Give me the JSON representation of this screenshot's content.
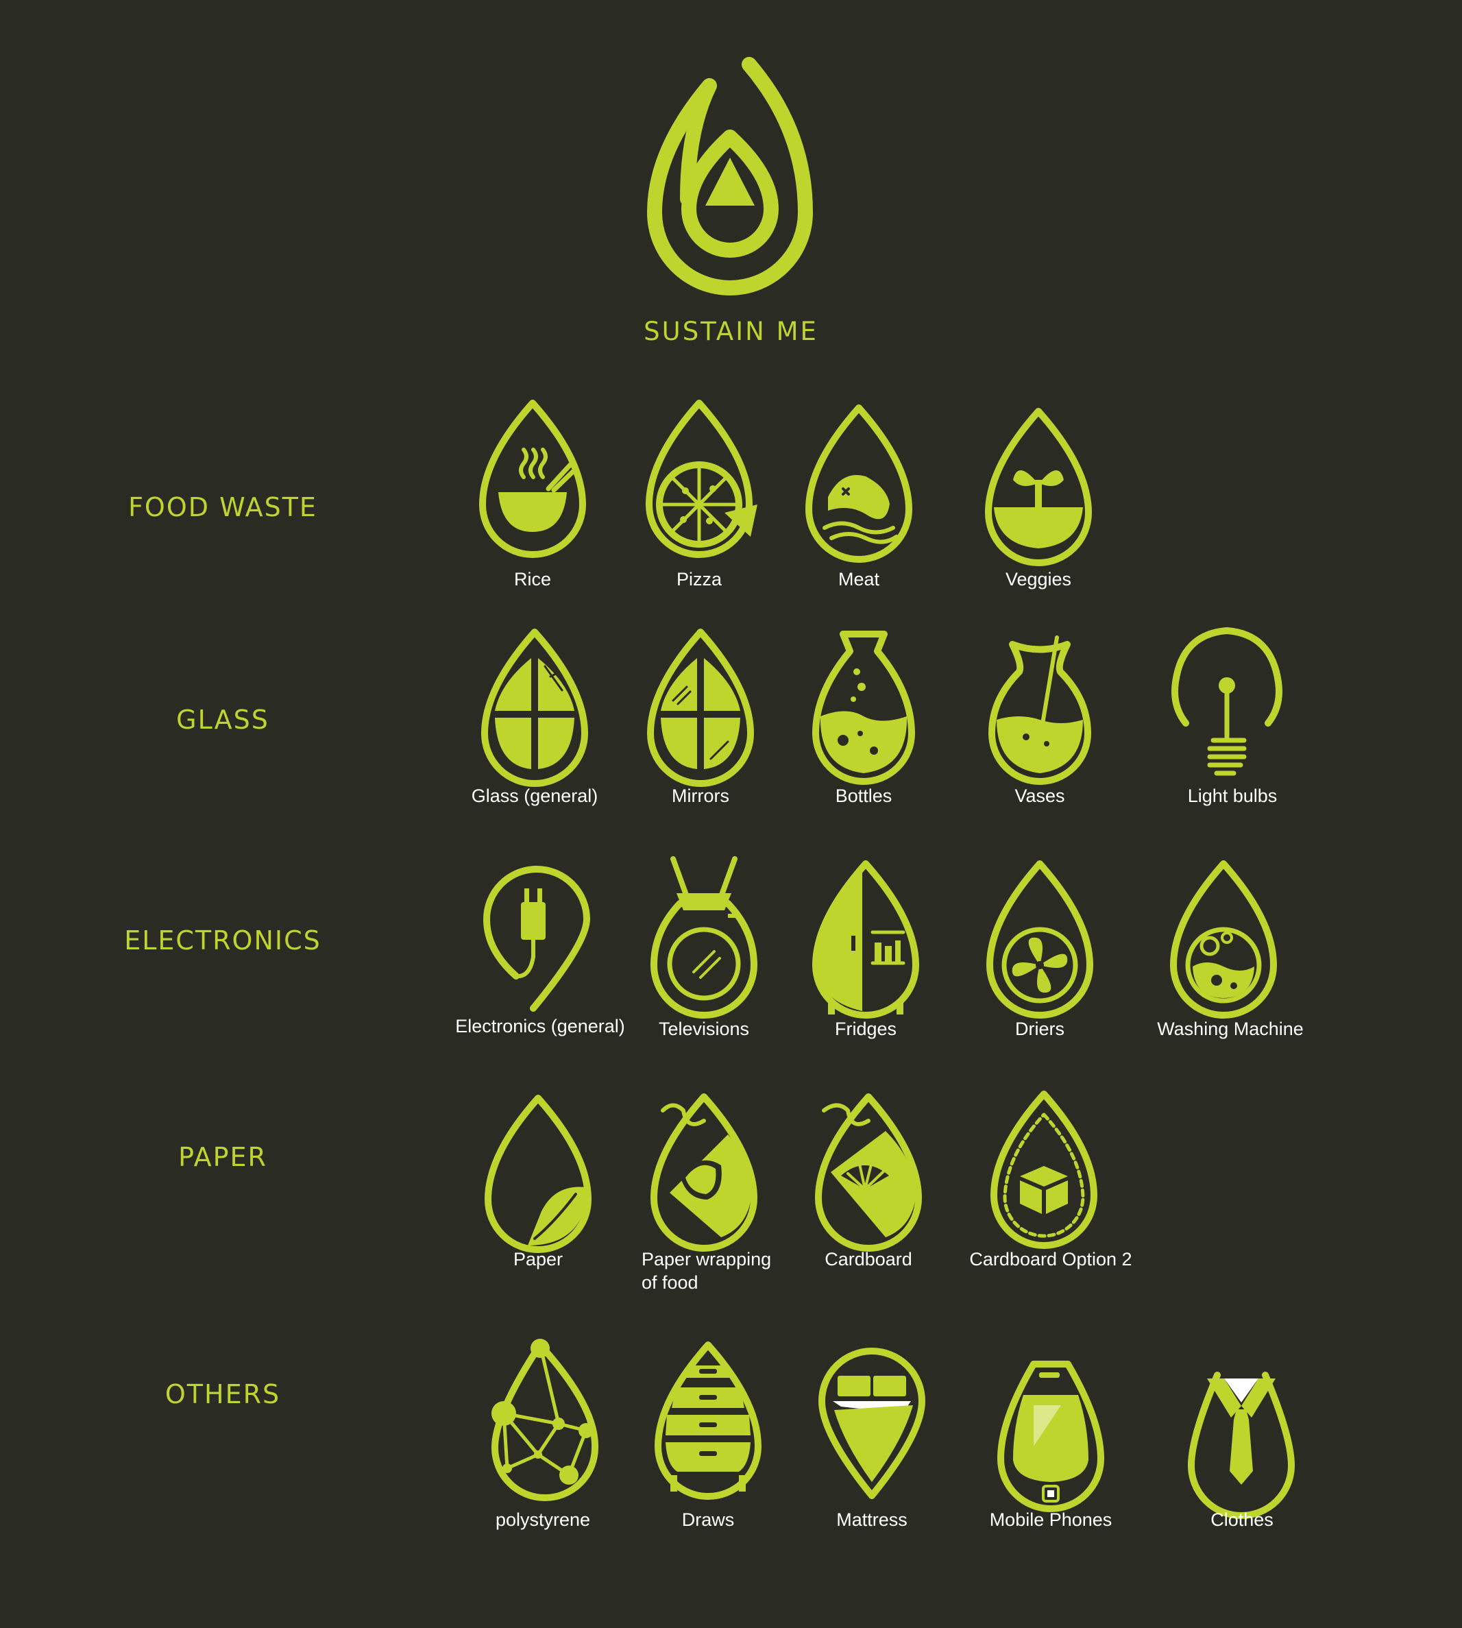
{
  "brand": {
    "title": "SUSTAIN ME"
  },
  "colors": {
    "background": "#2a2b23",
    "accent": "#bdd52d",
    "label": "#ffffff"
  },
  "categories": [
    {
      "name": "FOOD WASTE",
      "items": [
        {
          "label": "Rice",
          "icon": "rice-bowl-icon"
        },
        {
          "label": "Pizza",
          "icon": "pizza-icon"
        },
        {
          "label": "Meat",
          "icon": "fish-icon"
        },
        {
          "label": "Veggies",
          "icon": "sprout-icon"
        }
      ]
    },
    {
      "name": "GLASS",
      "items": [
        {
          "label": "Glass (general)",
          "icon": "window-icon"
        },
        {
          "label": "Mirrors",
          "icon": "mirror-icon"
        },
        {
          "label": "Bottles",
          "icon": "bottle-icon"
        },
        {
          "label": "Vases",
          "icon": "vase-icon"
        },
        {
          "label": "Light bulbs",
          "icon": "light-bulb-icon"
        }
      ]
    },
    {
      "name": "ELECTRONICS",
      "items": [
        {
          "label": "Electronics (general)",
          "icon": "plug-icon"
        },
        {
          "label": "Televisions",
          "icon": "television-icon"
        },
        {
          "label": "Fridges",
          "icon": "fridge-icon"
        },
        {
          "label": "Driers",
          "icon": "fan-icon"
        },
        {
          "label": "Washing Machine",
          "icon": "washing-machine-icon"
        }
      ]
    },
    {
      "name": "PAPER",
      "items": [
        {
          "label": "Paper",
          "icon": "paper-curl-icon"
        },
        {
          "label": "Paper wrapping of food",
          "label_line1": "Paper wrapping",
          "label_line2": "of food",
          "icon": "food-wrap-icon"
        },
        {
          "label": "Cardboard",
          "icon": "cardboard-icon"
        },
        {
          "label": "Cardboard Option 2",
          "icon": "box-icon"
        }
      ]
    },
    {
      "name": "OTHERS",
      "items": [
        {
          "label": "polystyrene",
          "icon": "molecule-icon"
        },
        {
          "label": "Draws",
          "icon": "drawers-icon"
        },
        {
          "label": "Mattress",
          "icon": "mattress-icon"
        },
        {
          "label": "Mobile Phones",
          "icon": "mobile-phone-icon"
        },
        {
          "label": "Clothes",
          "icon": "shirt-tie-icon"
        }
      ]
    }
  ]
}
